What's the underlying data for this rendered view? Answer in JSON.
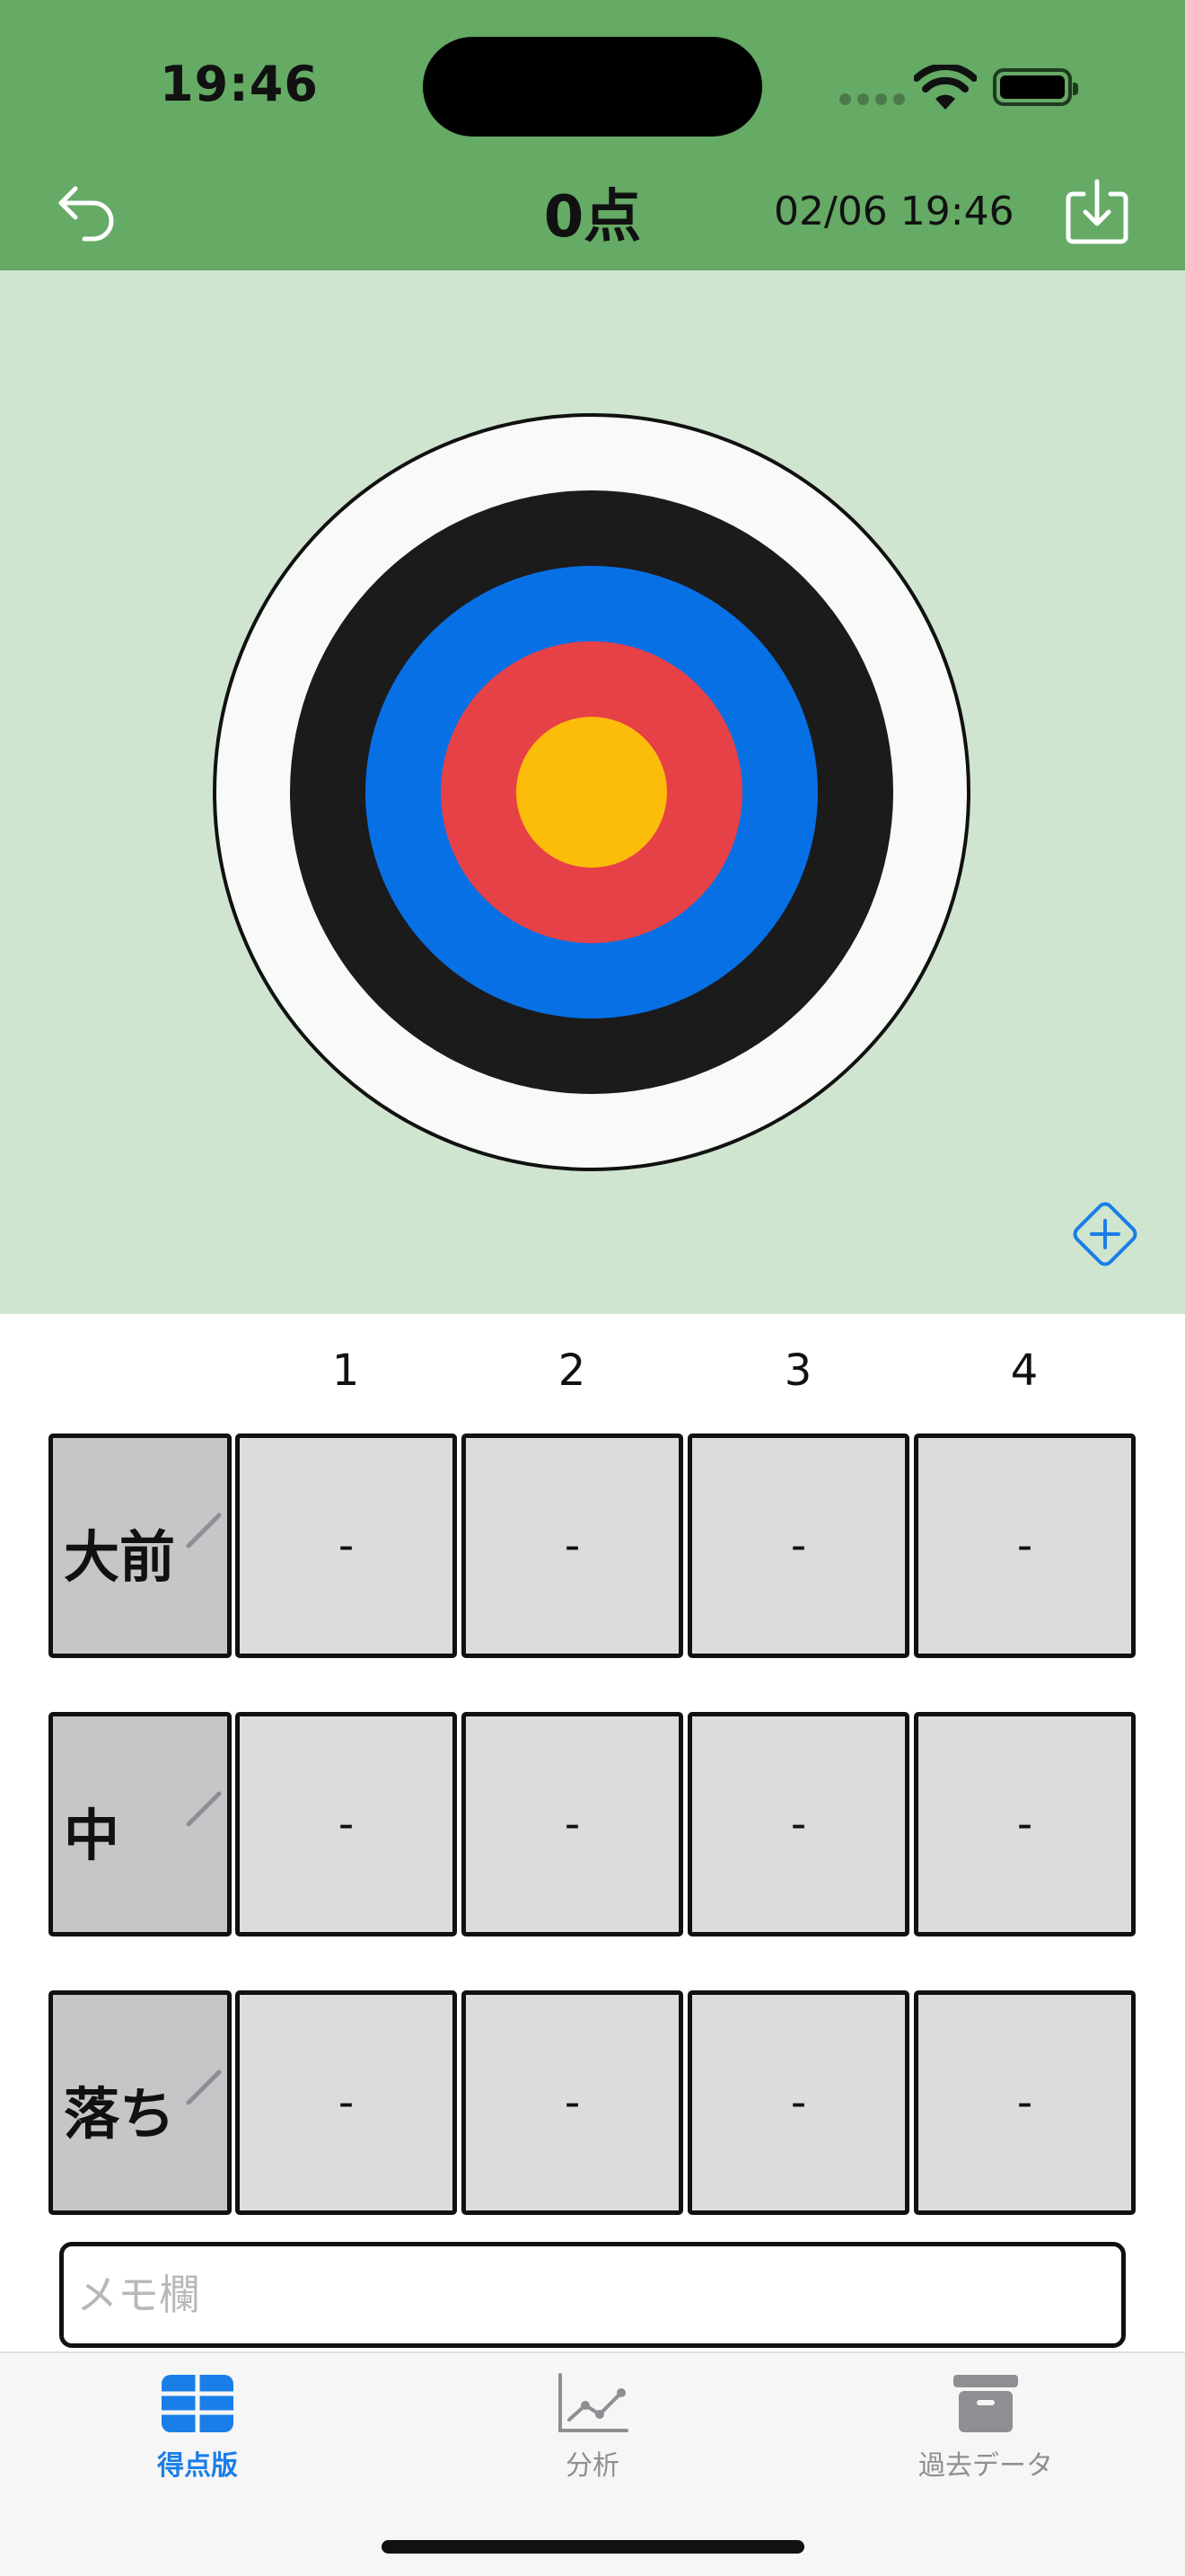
{
  "status_bar": {
    "time": "19:46"
  },
  "nav": {
    "title": "0点",
    "date": "02/06 19:46"
  },
  "target": {
    "rings": [
      "white",
      "black",
      "blue",
      "red",
      "yellow"
    ],
    "colors": {
      "white": "#f8faf8",
      "black": "#1b1b1b",
      "blue": "#0870e5",
      "red": "#e64146",
      "yellow": "#fcbd0a"
    }
  },
  "grid": {
    "columns": [
      "1",
      "2",
      "3",
      "4"
    ],
    "rows": [
      {
        "label": "大前",
        "cells": [
          "-",
          "-",
          "-",
          "-"
        ]
      },
      {
        "label": "中",
        "cells": [
          "-",
          "-",
          "-",
          "-"
        ]
      },
      {
        "label": "落ち",
        "cells": [
          "-",
          "-",
          "-",
          "-"
        ]
      }
    ]
  },
  "memo": {
    "placeholder": "メモ欄",
    "value": ""
  },
  "tabs": [
    {
      "label": "得点版",
      "icon": "table-icon",
      "active": true
    },
    {
      "label": "分析",
      "icon": "chart-icon",
      "active": false
    },
    {
      "label": "過去データ",
      "icon": "archive-icon",
      "active": false
    }
  ],
  "colors": {
    "header_green": "#65aa65",
    "target_bg": "#cfe5cf",
    "accent_blue": "#1a7ee8"
  }
}
